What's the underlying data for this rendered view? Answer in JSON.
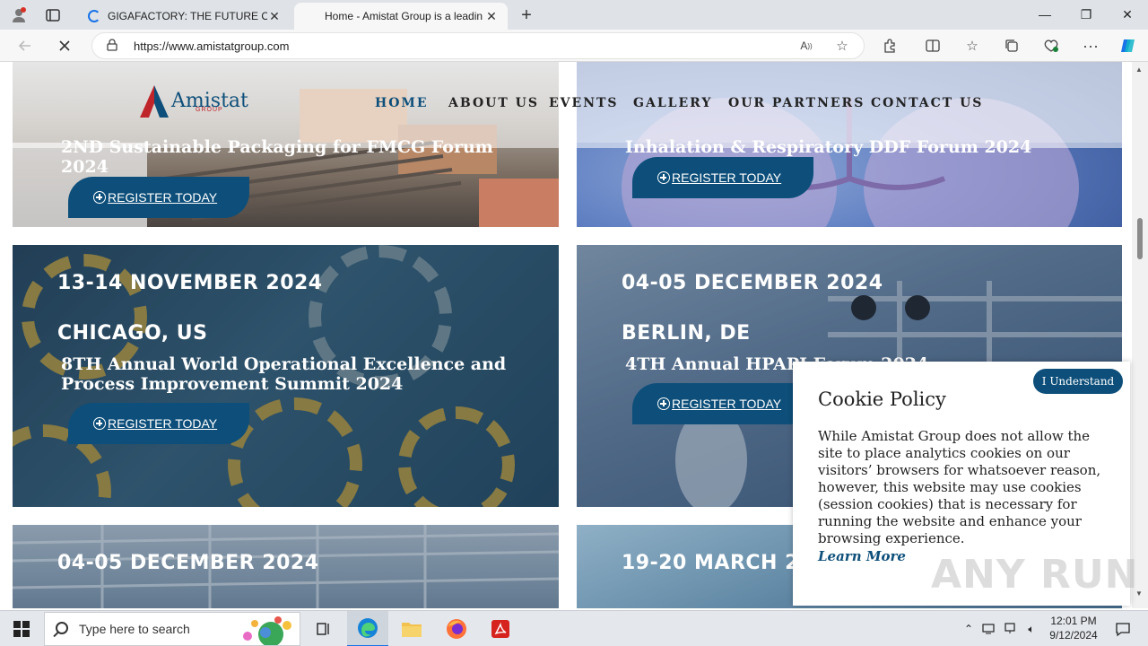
{
  "browser": {
    "tabs": [
      {
        "title": "GIGAFACTORY: THE FUTURE OF E",
        "active": false
      },
      {
        "title": "Home - Amistat Group is a leadin",
        "active": true
      }
    ],
    "url": "https://www.amistatgroup.com"
  },
  "site": {
    "logo_text": "Amistat",
    "logo_sub": "GROUP",
    "nav": [
      "HOME",
      "ABOUT US",
      "EVENTS",
      "GALLERY",
      "OUR PARTNERS",
      "CONTACT US"
    ],
    "active_nav": "HOME",
    "register_label": "REGISTER TODAY",
    "events": [
      {
        "date": "",
        "city": "",
        "title": "2ND Sustainable Packaging for FMCG Forum 2024"
      },
      {
        "date": "",
        "city": "",
        "title": "Inhalation & Respiratory DDF Forum 2024"
      },
      {
        "date": "13-14 NOVEMBER 2024",
        "city": "CHICAGO, US",
        "title": "8TH Annual World Operational Excellence and Process Improvement Summit 2024"
      },
      {
        "date": "04-05 DECEMBER 2024",
        "city": "BERLIN, DE",
        "title": "4TH Annual HPAPI Forum 2024"
      },
      {
        "date": "04-05 DECEMBER 2024",
        "city": "",
        "title": ""
      },
      {
        "date": "19-20 MARCH 2",
        "city": "",
        "title": ""
      }
    ]
  },
  "cookie": {
    "button": "I Understand",
    "title": "Cookie Policy",
    "body": "While Amistat Group does not allow the site to place analytics cookies on our visitors’ browsers for whatsoever reason, however, this website may use cookies (session cookies) that is necessary for running the website and enhance your browsing experience.",
    "link": "Learn More"
  },
  "watermark": "ANY RUN",
  "taskbar": {
    "search_placeholder": "Type here to search",
    "time": "12:01 PM",
    "date": "9/12/2024"
  },
  "colors": {
    "brand": "#0d4f7a",
    "brand_red": "#c0242b"
  }
}
